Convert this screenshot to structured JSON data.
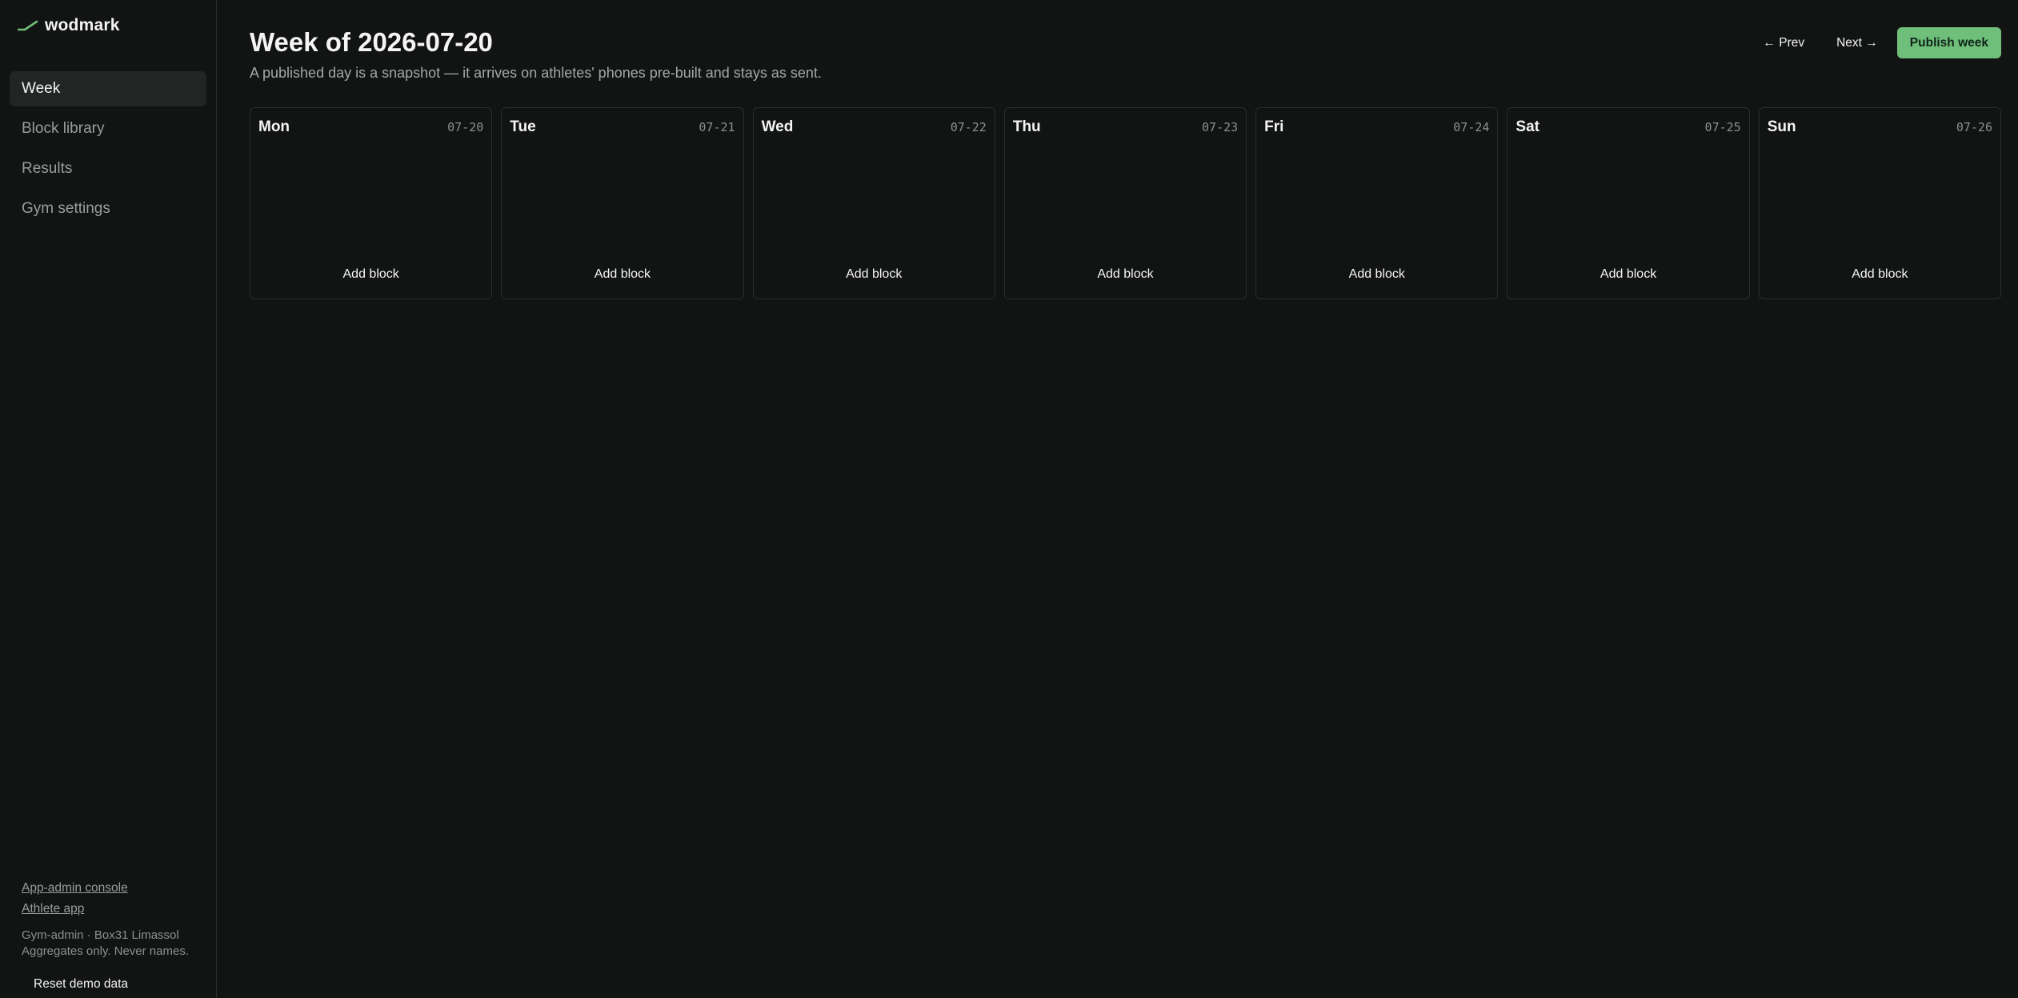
{
  "brand": {
    "name": "wodmark",
    "accent": "#6fbf7a"
  },
  "sidebar": {
    "items": [
      {
        "label": "Week",
        "active": true
      },
      {
        "label": "Block library",
        "active": false
      },
      {
        "label": "Results",
        "active": false
      },
      {
        "label": "Gym settings",
        "active": false
      }
    ],
    "footer": {
      "admin_console": "App-admin console",
      "athlete_app": "Athlete app",
      "note": "Gym-admin · Box31 Limassol Aggregates only. Never names.",
      "reset": "Reset demo data"
    }
  },
  "header": {
    "title": "Week of 2026-07-20",
    "subtitle": "A published day is a snapshot — it arrives on athletes' phones pre-built and stays as sent.",
    "prev": "← Prev",
    "next": "Next →",
    "publish": "Publish week"
  },
  "days": [
    {
      "name": "Mon",
      "date": "07-20",
      "add": "Add block"
    },
    {
      "name": "Tue",
      "date": "07-21",
      "add": "Add block"
    },
    {
      "name": "Wed",
      "date": "07-22",
      "add": "Add block"
    },
    {
      "name": "Thu",
      "date": "07-23",
      "add": "Add block"
    },
    {
      "name": "Fri",
      "date": "07-24",
      "add": "Add block"
    },
    {
      "name": "Sat",
      "date": "07-25",
      "add": "Add block"
    },
    {
      "name": "Sun",
      "date": "07-26",
      "add": "Add block"
    }
  ]
}
